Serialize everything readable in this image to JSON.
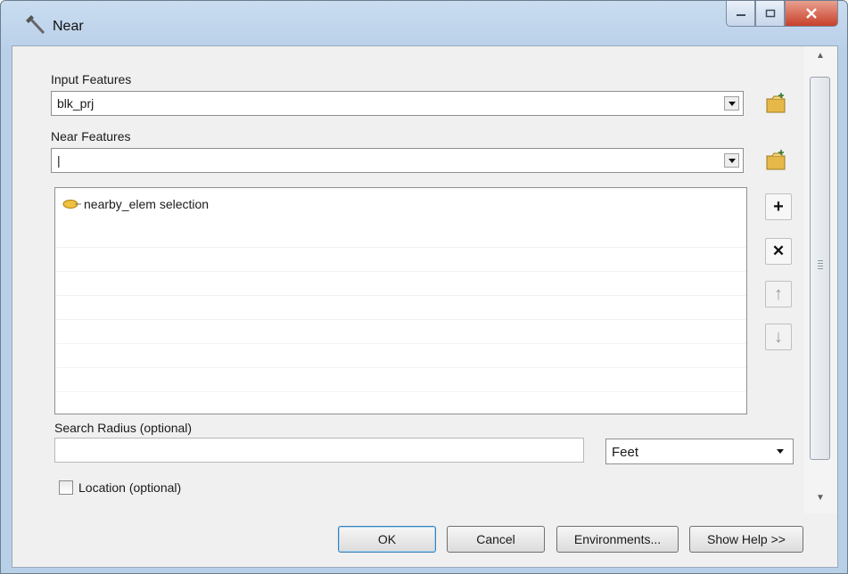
{
  "window": {
    "title": "Near",
    "controls": [
      "minimize",
      "maximize",
      "close"
    ]
  },
  "form": {
    "input_features": {
      "label": "Input Features",
      "value": "blk_prj"
    },
    "near_features": {
      "label": "Near Features",
      "value": "|"
    },
    "near_list": [
      {
        "label": "nearby_elem selection",
        "icon": "layer-selection-icon"
      }
    ],
    "list_buttons": [
      {
        "name": "add-icon",
        "glyph": "+",
        "enabled": true
      },
      {
        "name": "remove-icon",
        "glyph": "✕",
        "enabled": true
      },
      {
        "name": "move-up-icon",
        "glyph": "↑",
        "enabled": false
      },
      {
        "name": "move-down-icon",
        "glyph": "↓",
        "enabled": false
      }
    ],
    "search_radius": {
      "label": "Search Radius (optional)",
      "value": "",
      "unit": "Feet"
    },
    "location": {
      "label": "Location (optional)",
      "checked": false
    }
  },
  "buttons": {
    "ok": "OK",
    "cancel": "Cancel",
    "environments": "Environments...",
    "show_help": "Show Help >>"
  },
  "colors": {
    "titlebar": "#c9dcf0",
    "close_button": "#c8402a",
    "folder_icon": "#e6b84a"
  }
}
